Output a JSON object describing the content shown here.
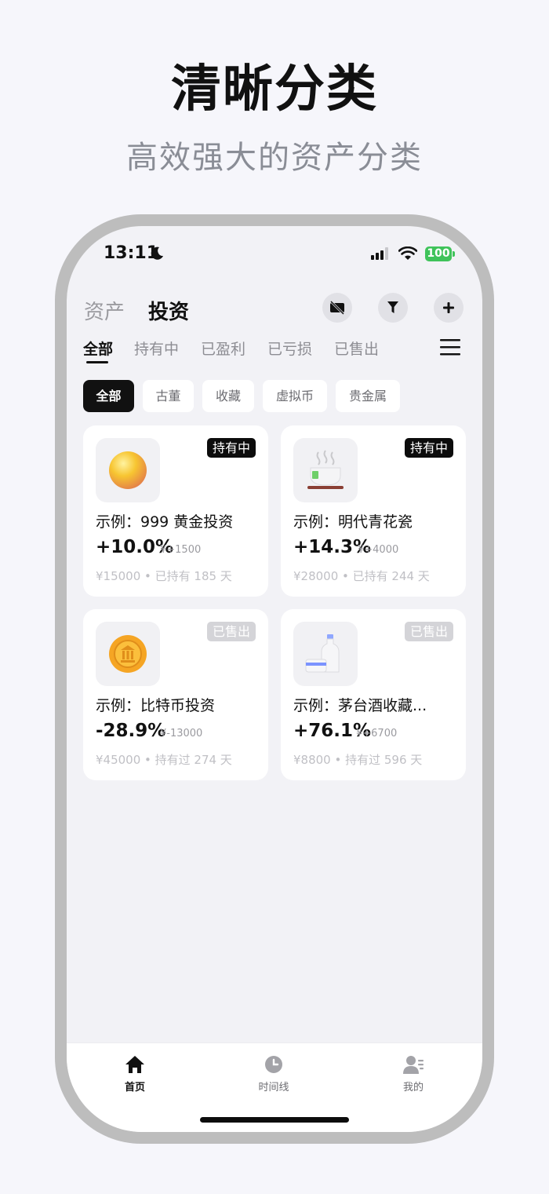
{
  "hero": {
    "title": "清晰分类",
    "subtitle": "高效强大的资产分类"
  },
  "status": {
    "time": "13:11",
    "battery": "100"
  },
  "header": {
    "tab_assets": "资产",
    "tab_invest": "投资"
  },
  "segments": [
    "全部",
    "持有中",
    "已盈利",
    "已亏损",
    "已售出"
  ],
  "chips": [
    "全部",
    "古董",
    "收藏",
    "虚拟币",
    "贵金属"
  ],
  "cards": [
    {
      "status": "持有中",
      "name": "示例：999 黄金投资",
      "pct": "+10.0%",
      "delta": "¥+1500",
      "meta": "¥15000 • 已持有 185 天",
      "icon": "gold-ball-icon"
    },
    {
      "status": "持有中",
      "name": "示例：明代青花瓷",
      "pct": "+14.3%",
      "delta": "¥+4000",
      "meta": "¥28000 • 已持有 244 天",
      "icon": "tea-bowl-icon"
    },
    {
      "status": "已售出",
      "name": "示例：比特币投资",
      "pct": "-28.9%",
      "delta": "¥-13000",
      "meta": "¥45000 • 持有过 274 天",
      "icon": "coin-icon"
    },
    {
      "status": "已售出",
      "name": "示例：茅台酒收藏...",
      "pct": "+76.1%",
      "delta": "¥+6700",
      "meta": "¥8800 • 持有过 596 天",
      "icon": "liquor-bottle-icon"
    }
  ],
  "tabbar": {
    "home": "首页",
    "timeline": "时间线",
    "mine": "我的"
  },
  "colors": {
    "accent": "#111111",
    "battery": "#3fc35a",
    "sold_badge": "#d4d4d8"
  }
}
